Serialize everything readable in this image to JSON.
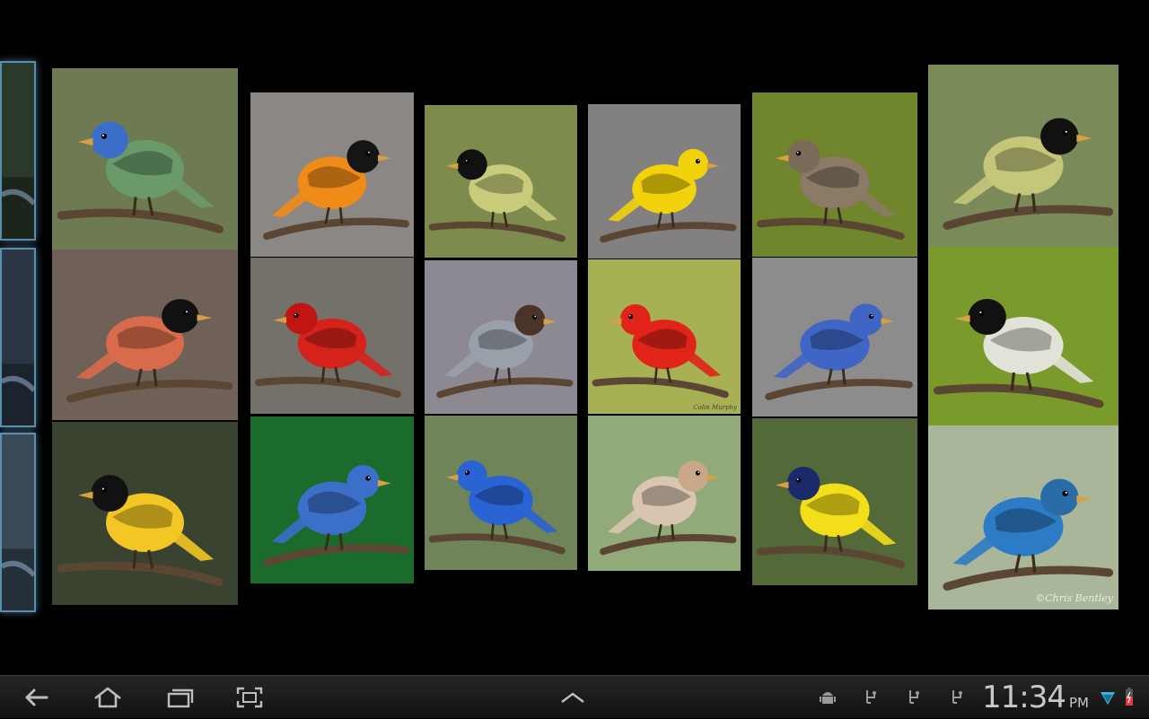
{
  "gallery": {
    "tiles": [
      {
        "icon": "bird-icon",
        "subject": "partial",
        "bg": "#2a3a2a"
      },
      {
        "icon": "bird-icon",
        "subject": "partial",
        "bg": "#2a3644"
      },
      {
        "icon": "bird-icon",
        "subject": "partial",
        "bg": "#3a4a58"
      },
      {
        "icon": "hummingbird-icon",
        "bg": "#6e7a52",
        "body": "#6a9a6a",
        "head": "#3a6ec8"
      },
      {
        "icon": "bullfinch-icon",
        "bg": "#6f6058",
        "body": "#d86b4b",
        "head": "#111111"
      },
      {
        "icon": "goldfinch-icon",
        "bg": "#3a4230",
        "body": "#f2c624",
        "head": "#111111"
      },
      {
        "icon": "oriole-icon",
        "bg": "#8a8784",
        "body": "#f08b1a",
        "head": "#151515"
      },
      {
        "icon": "cardinal-icon",
        "bg": "#74706a",
        "body": "#d5231c",
        "head": "#c01510"
      },
      {
        "icon": "blue-jay-icon",
        "bg": "#1b6b2c",
        "body": "#3b6fc9",
        "head": "#3b6fc9"
      },
      {
        "icon": "great-tit-icon",
        "bg": "#7d8c4c",
        "body": "#c8cc7a",
        "head": "#111111"
      },
      {
        "icon": "gull-icon",
        "bg": "#8d8992",
        "body": "#9aa0aa",
        "head": "#4a3328"
      },
      {
        "icon": "indigo-bunting-icon",
        "bg": "#6f8458",
        "body": "#2a63d4",
        "head": "#2a63d4"
      },
      {
        "icon": "canary-icon",
        "bg": "#828080",
        "body": "#f2d20a",
        "head": "#f2d20a"
      },
      {
        "icon": "tanager-icon",
        "bg": "#a7b153",
        "body": "#e0241a",
        "head": "#e0241a"
      },
      {
        "icon": "female-cardinal-icon",
        "bg": "#92aa7a",
        "body": "#d9c5b0",
        "head": "#c8a888"
      },
      {
        "icon": "mockingbird-icon",
        "bg": "#70862c",
        "body": "#8a7a66",
        "head": "#7a6a58"
      },
      {
        "icon": "bluebird-icon",
        "bg": "#8c8c8c",
        "body": "#3f66c4",
        "head": "#3f66c4"
      },
      {
        "icon": "tanager-yellow-icon",
        "bg": "#536a38",
        "body": "#f3de1a",
        "head": "#1a2a6a"
      },
      {
        "icon": "great-tit-icon",
        "bg": "#7a8a58",
        "body": "#c4c67a",
        "head": "#111111"
      },
      {
        "icon": "chickadee-icon",
        "bg": "#7a9a2c",
        "body": "#e2e2d8",
        "head": "#111111"
      },
      {
        "icon": "kingfisher-icon",
        "bg": "#a9b69a",
        "body": "#2d7bc4",
        "head": "#2a6ca8"
      }
    ],
    "watermarks": {
      "tanager": "Colin Murphy",
      "kingfisher": "©Chris Bentley"
    }
  },
  "system_bar": {
    "time": "11:34",
    "ampm": "PM",
    "nav": [
      "back-icon",
      "home-icon",
      "recent-apps-icon",
      "screenshot-icon"
    ],
    "notifications": [
      "android-debug-icon",
      "usb-icon",
      "usb-icon",
      "usb-icon"
    ],
    "status": [
      "wifi-icon",
      "battery-icon"
    ]
  }
}
